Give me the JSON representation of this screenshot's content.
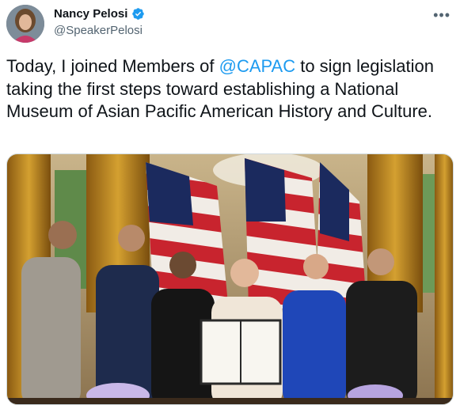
{
  "user": {
    "display_name": "Nancy Pelosi",
    "handle": "@SpeakerPelosi",
    "verified": true,
    "verified_icon": "verified-badge-icon",
    "avatar_icon": "profile-avatar"
  },
  "tweet": {
    "text_before": "Today, I joined Members of ",
    "mention": "@CAPAC",
    "text_after": " to sign legislation taking the first steps toward establishing a National Museum of Asian Pacific American History and Culture."
  },
  "menu": {
    "more_label": "•••",
    "icon": "more-options-icon"
  },
  "colors": {
    "accent": "#1d9bf0",
    "text": "#0f1419",
    "secondary": "#536471"
  },
  "media": {
    "type": "photo"
  }
}
